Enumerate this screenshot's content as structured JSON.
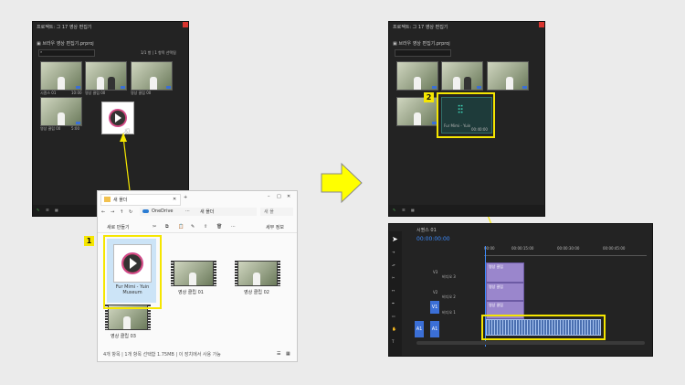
{
  "left_panel": {
    "title": "프로젝트: 그 17 영상 편집기",
    "subtitle": "▣ 브라우 영상 편집기.prproj",
    "status": "1/1 항 | 1 항목 선택됨",
    "thumbnails": [
      {
        "label": "시퀀스 01",
        "duration": "10:00"
      },
      {
        "label": "영상 클립 00",
        "duration": "2:00"
      },
      {
        "label": "영상 클립 00",
        "duration": "3:01"
      },
      {
        "label": "영상 클립 00",
        "duration": "5:00"
      }
    ]
  },
  "right_panel": {
    "title": "프로젝트: 그 17 영상 편집기",
    "subtitle": "▣ 브라우 영상 편집기.prproj",
    "audio_clip_label": "Fur Mimi - Yuin",
    "audio_clip_duration": "00:40:00"
  },
  "explorer": {
    "tab": "새 폴더",
    "path": [
      "OneDrive",
      "⋯",
      "새 폴더"
    ],
    "search_placeholder": "새 폴",
    "toolbar": {
      "new": "새로 만들기",
      "details": "세부 정보"
    },
    "files": [
      {
        "name": "Fur Mimi - Yuin Museum"
      },
      {
        "name": "영상 클립 01"
      },
      {
        "name": "영상 클립 02"
      },
      {
        "name": "영상 클립 03"
      }
    ],
    "status": "4개 항목  |  1개 항목 선택함 1.75MB  |  이 장치에서 사용 가능"
  },
  "timeline": {
    "title": "시퀀스 01",
    "timecode": "00:00:00:00",
    "ruler": [
      "00:00",
      "00:00:15:00",
      "00:00:30:00",
      "00:00:45:00"
    ],
    "tracks": [
      {
        "name": "V3",
        "label": "비디오 3"
      },
      {
        "name": "V2",
        "label": "비디오 2"
      },
      {
        "name": "V1",
        "label": "비디오 1"
      },
      {
        "name": "A1",
        "label": ""
      }
    ],
    "clips": [
      "영상 클립",
      "영상 클립",
      "영상 클립"
    ]
  },
  "callouts": {
    "one": "1",
    "two": "2"
  },
  "colors": {
    "highlight": "#f5e600",
    "arrow": "#ffff00",
    "panel": "#232323"
  }
}
